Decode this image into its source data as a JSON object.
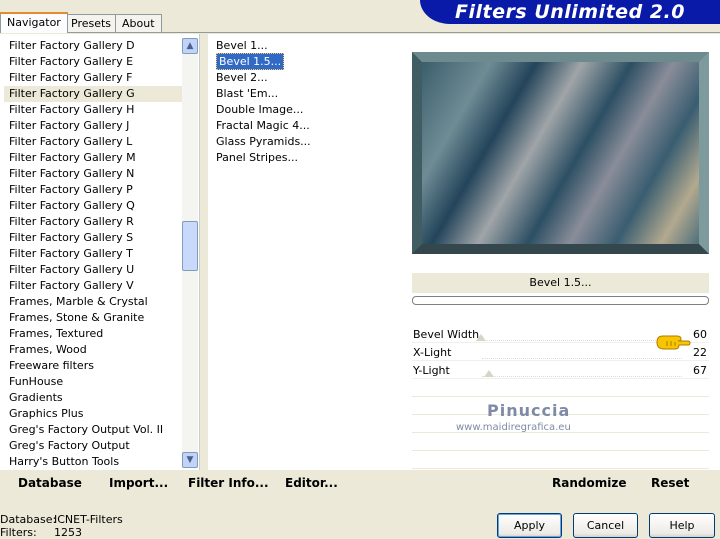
{
  "tabs": [
    {
      "label": "Navigator",
      "active": true
    },
    {
      "label": "Presets",
      "active": false
    },
    {
      "label": "About",
      "active": false
    }
  ],
  "banner": {
    "title": "Filters Unlimited 2.0"
  },
  "categories": {
    "selected": "Filter Factory Gallery G",
    "items": [
      "Filter Factory Gallery D",
      "Filter Factory Gallery E",
      "Filter Factory Gallery F",
      "Filter Factory Gallery G",
      "Filter Factory Gallery H",
      "Filter Factory Gallery J",
      "Filter Factory Gallery L",
      "Filter Factory Gallery M",
      "Filter Factory Gallery N",
      "Filter Factory Gallery P",
      "Filter Factory Gallery Q",
      "Filter Factory Gallery R",
      "Filter Factory Gallery S",
      "Filter Factory Gallery T",
      "Filter Factory Gallery U",
      "Filter Factory Gallery V",
      "Frames, Marble & Crystal",
      "Frames, Stone & Granite",
      "Frames, Textured",
      "Frames, Wood",
      "Freeware filters",
      "FunHouse",
      "Gradients",
      "Graphics Plus",
      "Greg's Factory Output Vol. II",
      "Greg's Factory Output",
      "Harry's Button Tools"
    ]
  },
  "filters": {
    "selected": "Bevel 1.5...",
    "items": [
      "Bevel 1...",
      "Bevel 1.5...",
      "Bevel 2...",
      "Blast 'Em...",
      "Double Image...",
      "Fractal Magic 4...",
      "Glass Pyramids...",
      "Panel Stripes..."
    ]
  },
  "preview": {
    "filter_title": "Bevel 1.5...",
    "progress": 0
  },
  "params": [
    {
      "label": "Bevel Width",
      "value": "60"
    },
    {
      "label": "X-Light",
      "value": "22"
    },
    {
      "label": "Y-Light",
      "value": "67"
    }
  ],
  "watermark": {
    "name": "Pinuccia",
    "url": "www.maidiregrafica.eu"
  },
  "toolbar": {
    "database": "Database",
    "import": "Import...",
    "filter_info": "Filter Info...",
    "editor": "Editor...",
    "randomize": "Randomize",
    "reset": "Reset"
  },
  "status": {
    "database_label": "Database:",
    "database_value": "ICNET-Filters",
    "filters_label": "Filters:",
    "filters_value": "1253"
  },
  "buttons": {
    "apply": "Apply",
    "cancel": "Cancel",
    "help": "Help"
  },
  "colors": {
    "banner": "#0a1aa8",
    "selection": "#316ac5",
    "dialog_bg": "#ece9d8"
  }
}
